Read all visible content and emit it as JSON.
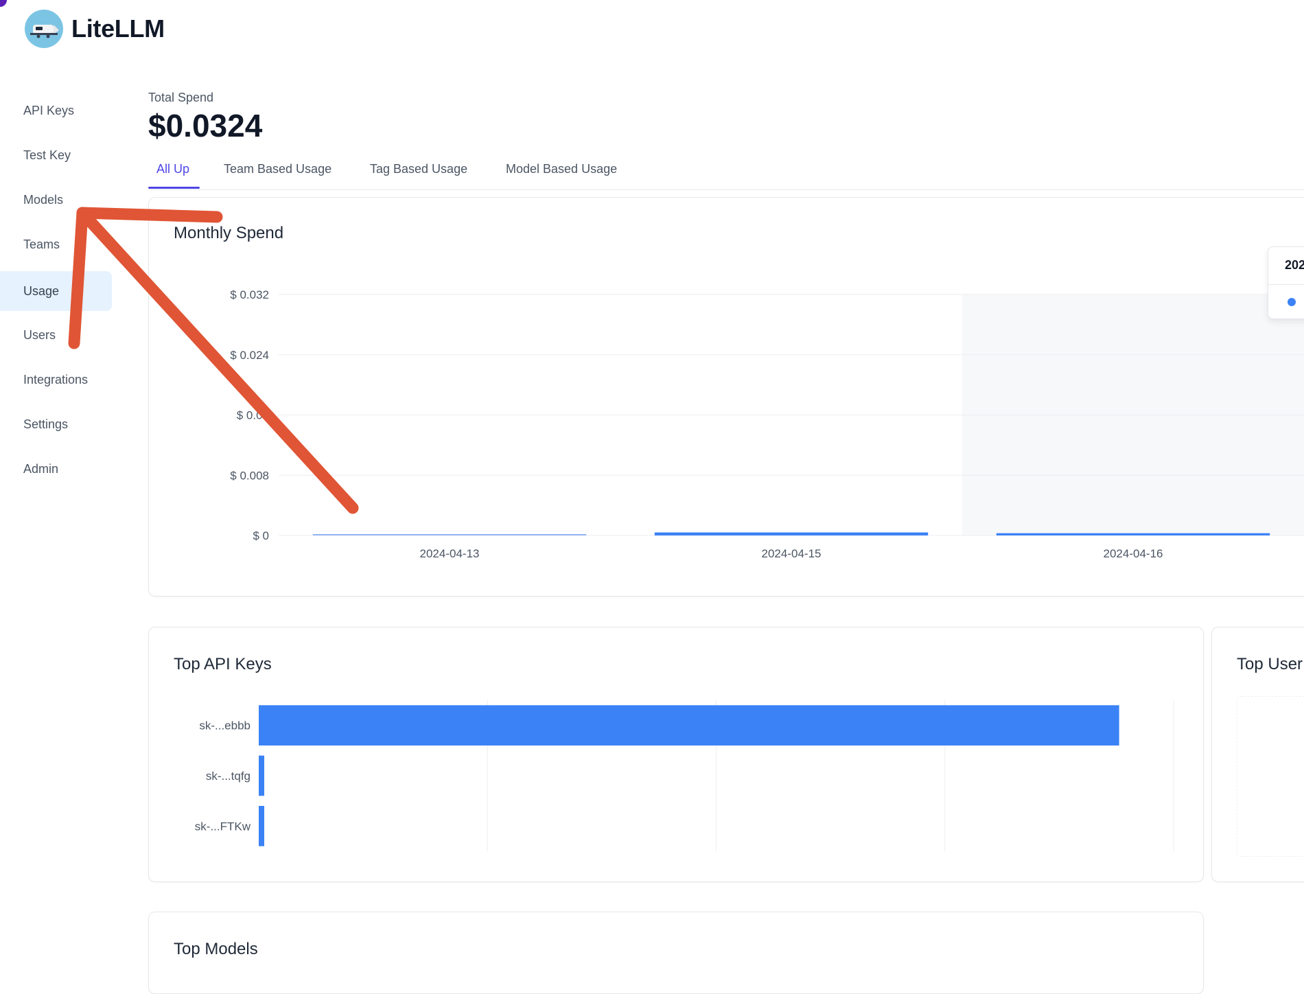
{
  "app": {
    "name": "LiteLLM"
  },
  "sidebar": {
    "items": [
      {
        "label": "API Keys"
      },
      {
        "label": "Test Key"
      },
      {
        "label": "Models"
      },
      {
        "label": "Teams"
      },
      {
        "label": "Usage",
        "active": true
      },
      {
        "label": "Users"
      },
      {
        "label": "Integrations"
      },
      {
        "label": "Settings"
      },
      {
        "label": "Admin"
      }
    ]
  },
  "summary": {
    "label": "Total Spend",
    "value": "$0.0324"
  },
  "tabs": [
    {
      "label": "All Up",
      "active": true
    },
    {
      "label": "Team Based Usage"
    },
    {
      "label": "Tag Based Usage"
    },
    {
      "label": "Model Based Usage"
    }
  ],
  "monthly_spend": {
    "title": "Monthly Spend",
    "tooltip_date": "202"
  },
  "top_api_keys": {
    "title": "Top API Keys"
  },
  "top_users": {
    "title": "Top User"
  },
  "top_models": {
    "title": "Top Models"
  },
  "colors": {
    "accent": "#4f46e5",
    "bar": "#3b82f6",
    "active_nav_bg": "#e6f2fd",
    "annotation_arrow": "#e05535"
  },
  "icons": {
    "logo": "train-logo-icon",
    "annotation": "red-arrow-annotation-icon"
  },
  "chart_data": [
    {
      "type": "bar",
      "title": "Monthly Spend",
      "categories": [
        "2024-04-13",
        "2024-04-15",
        "2024-04-16"
      ],
      "values": [
        0.0001,
        0.0004,
        0.0003
      ],
      "ylim": [
        0,
        0.032
      ],
      "y_ticks": [
        0,
        0.008,
        0.016,
        0.024,
        0.032
      ],
      "y_tick_labels": [
        "$ 0",
        "$ 0.008",
        "$ 0.01",
        "$ 0.024",
        "$ 0.032"
      ],
      "grid": true
    },
    {
      "type": "bar",
      "orientation": "horizontal",
      "title": "Top API Keys",
      "categories": [
        "sk-...ebbb",
        "sk-...tqfg",
        "sk-...FTKw"
      ],
      "values": [
        0.0316,
        0.0002,
        0.00015
      ],
      "xlim": [
        0,
        0.0336
      ],
      "grid": true
    }
  ]
}
